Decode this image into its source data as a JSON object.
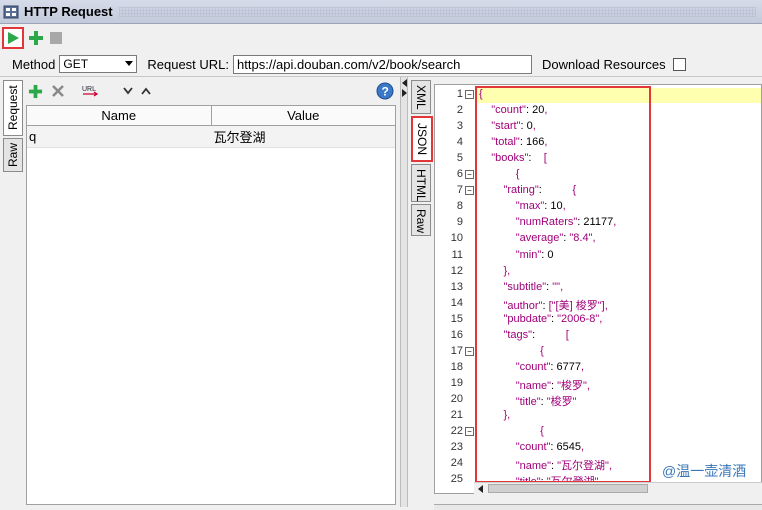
{
  "window": {
    "title": "HTTP Request"
  },
  "toolbar": {
    "run_icon": "play-icon",
    "add_icon": "plus-icon",
    "stop_icon": "stop-icon"
  },
  "request": {
    "method_label": "Method",
    "method_value": "GET",
    "url_label": "Request URL:",
    "url_value": "https://api.douban.com/v2/book/search",
    "download_label": "Download Resources",
    "download_checked": false
  },
  "left_tabs": [
    "Request",
    "Raw"
  ],
  "params": {
    "columns": [
      "Name",
      "Value"
    ],
    "rows": [
      {
        "name": "q",
        "value": "瓦尔登湖"
      }
    ]
  },
  "right_tabs": [
    "XML",
    "JSON",
    "HTML",
    "Raw"
  ],
  "editor": {
    "lines": [
      {
        "n": "1",
        "fold": true,
        "t": "{"
      },
      {
        "n": "2",
        "t": "    \"count\": 20,"
      },
      {
        "n": "3",
        "t": "    \"start\": 0,"
      },
      {
        "n": "4",
        "t": "    \"total\": 166,"
      },
      {
        "n": "5",
        "t": "    \"books\":    ["
      },
      {
        "n": "6",
        "fold": true,
        "t": "            {"
      },
      {
        "n": "7",
        "fold": true,
        "t": "        \"rating\":          {"
      },
      {
        "n": "8",
        "t": "            \"max\": 10,"
      },
      {
        "n": "9",
        "t": "            \"numRaters\": 21177,"
      },
      {
        "n": "10",
        "t": "            \"average\": \"8.4\","
      },
      {
        "n": "11",
        "t": "            \"min\": 0"
      },
      {
        "n": "12",
        "t": "        },"
      },
      {
        "n": "13",
        "t": "        \"subtitle\": \"\","
      },
      {
        "n": "14",
        "t": "        \"author\": [\"[美] 梭罗\"],"
      },
      {
        "n": "15",
        "t": "        \"pubdate\": \"2006-8\","
      },
      {
        "n": "16",
        "t": "        \"tags\":          ["
      },
      {
        "n": "17",
        "fold": true,
        "t": "                    {"
      },
      {
        "n": "18",
        "t": "            \"count\": 6777,"
      },
      {
        "n": "19",
        "t": "            \"name\": \"梭罗\","
      },
      {
        "n": "20",
        "t": "            \"title\": \"梭罗\""
      },
      {
        "n": "21",
        "t": "        },"
      },
      {
        "n": "22",
        "fold": true,
        "t": "                    {"
      },
      {
        "n": "23",
        "t": "            \"count\": 6545,"
      },
      {
        "n": "24",
        "t": "            \"name\": \"瓦尔登湖\","
      },
      {
        "n": "25",
        "t": "            \"title\": \"瓦尔登湖\""
      }
    ]
  },
  "watermark": "@温一壶清酒"
}
